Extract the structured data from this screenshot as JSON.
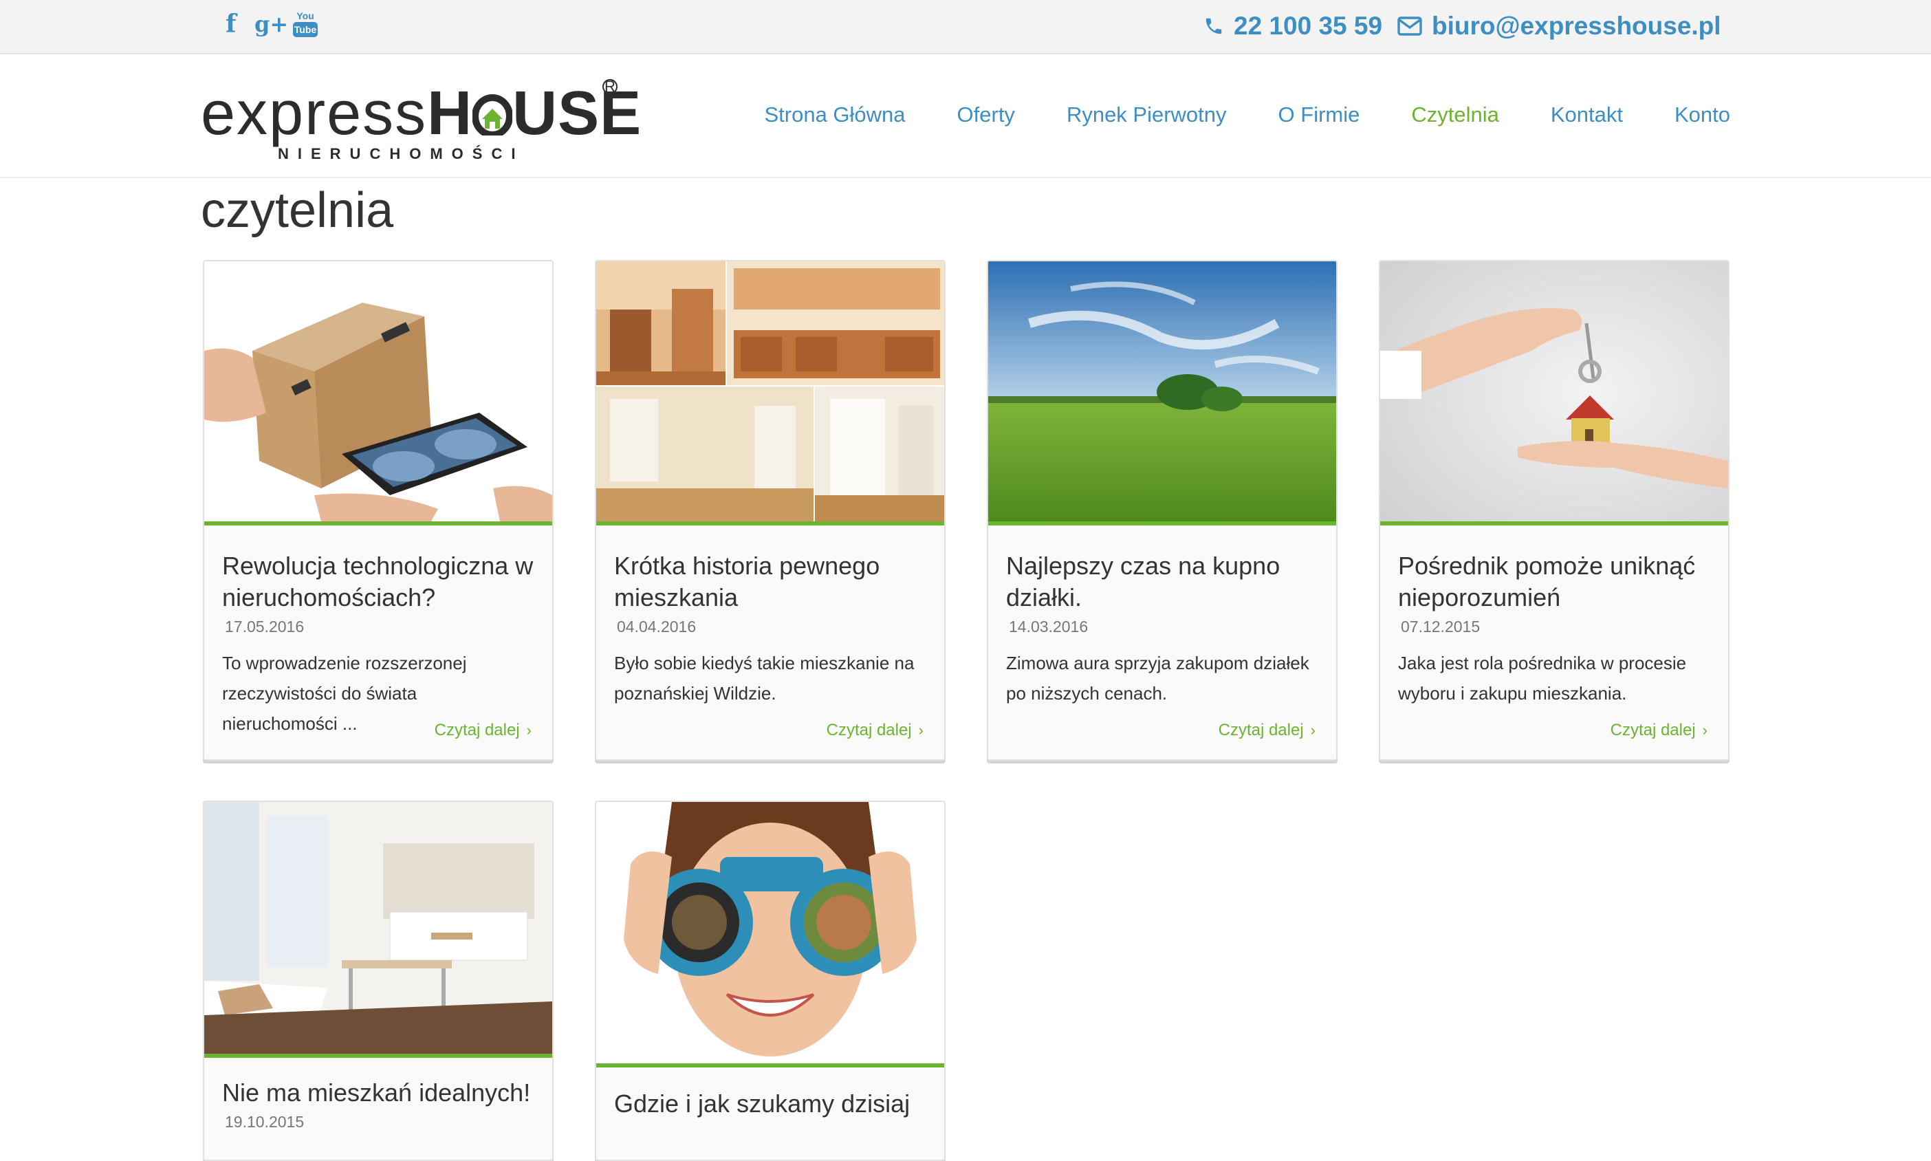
{
  "topbar": {
    "social": [
      {
        "name": "facebook-icon",
        "glyph": "f"
      },
      {
        "name": "google-plus-icon",
        "glyph": "g+"
      },
      {
        "name": "youtube-icon",
        "glyph_top": "You",
        "glyph_bottom": "Tube"
      }
    ],
    "phone": "22 100 35 59",
    "email": "biuro@expresshouse.pl"
  },
  "logo": {
    "word_left": "express",
    "word_h": "H",
    "word_right": "USE",
    "subtitle": "NIERUCHOMOŚCI",
    "registered": "R"
  },
  "nav": {
    "items": [
      {
        "label": "Strona Główna",
        "active": false
      },
      {
        "label": "Oferty",
        "active": false
      },
      {
        "label": "Rynek Pierwotny",
        "active": false
      },
      {
        "label": "O Firmie",
        "active": false
      },
      {
        "label": "Czytelnia",
        "active": true
      },
      {
        "label": "Kontakt",
        "active": false
      },
      {
        "label": "Konto",
        "active": false
      }
    ]
  },
  "page": {
    "title": "czytelnia"
  },
  "articles": [
    {
      "title": "Rewolucja technologiczna w nieruchomościach?",
      "date": "17.05.2016",
      "excerpt": "To wprowadzenie rozszerzonej rzeczywistości do świata nieruchomości ...",
      "more": "Czytaj dalej"
    },
    {
      "title": "Krótka historia pewnego mieszkania",
      "date": "04.04.2016",
      "excerpt": "Było sobie kiedyś takie mieszkanie na poznańskiej Wildzie.",
      "more": "Czytaj dalej"
    },
    {
      "title": "Najlepszy czas na kupno działki.",
      "date": "14.03.2016",
      "excerpt": "Zimowa aura sprzyja zakupom działek po niższych cenach.",
      "more": "Czytaj dalej"
    },
    {
      "title": "Pośrednik pomoże uniknąć nieporozumień",
      "date": "07.12.2015",
      "excerpt": "Jaka jest rola pośrednika w procesie wyboru i zakupu mieszkania.",
      "more": "Czytaj dalej"
    },
    {
      "title": "Nie ma mieszkań idealnych!",
      "date": "19.10.2015",
      "excerpt": "",
      "more": ""
    },
    {
      "title": "Gdzie i jak szukamy dzisiaj",
      "date": "",
      "excerpt": "",
      "more": ""
    }
  ],
  "colors": {
    "blue": "#3d8ec2",
    "green": "#6cb332",
    "text": "#333333"
  }
}
